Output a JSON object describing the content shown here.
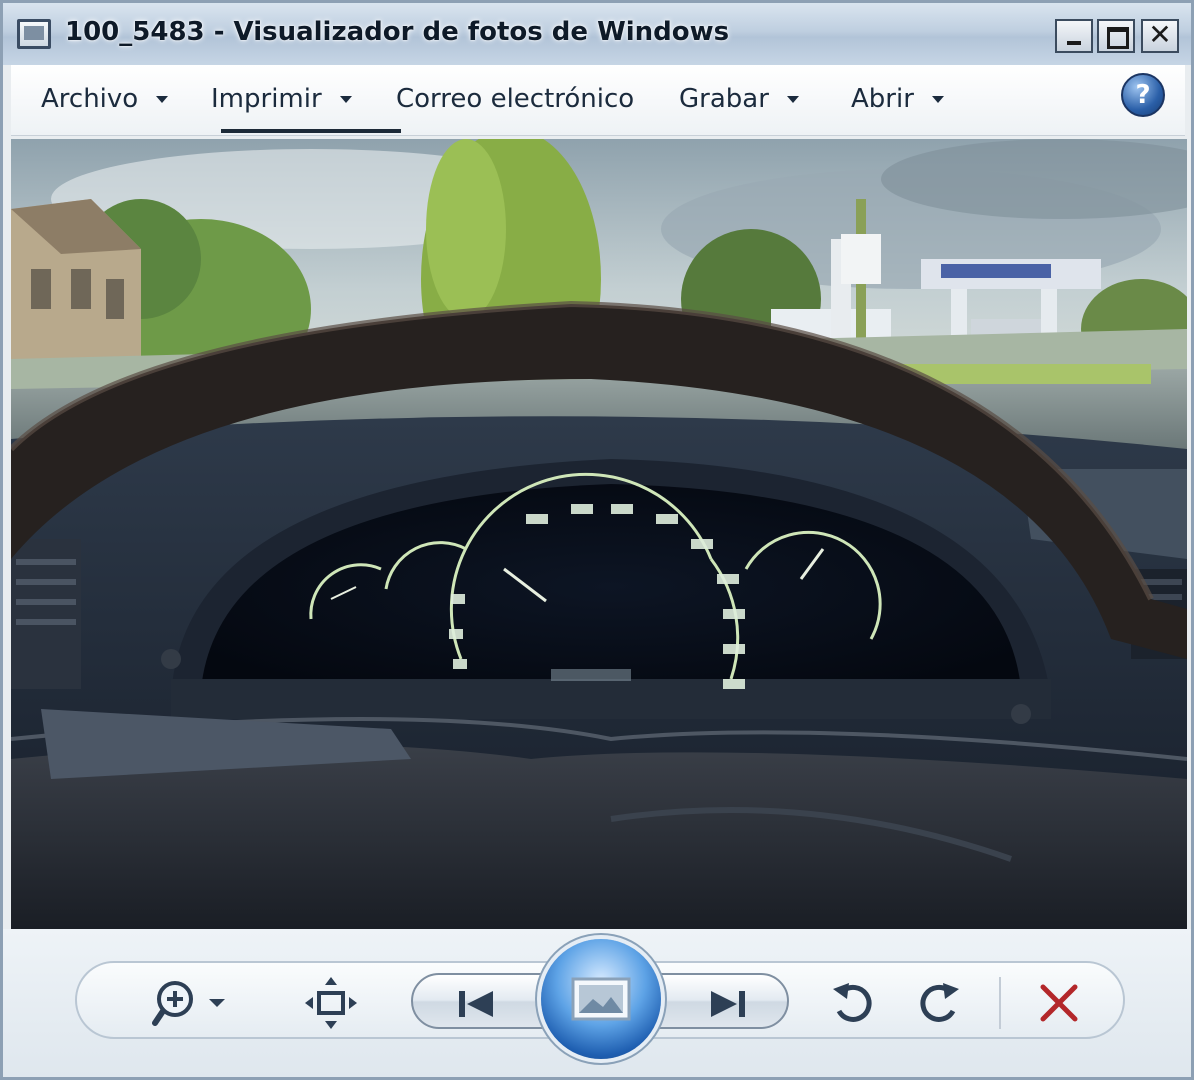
{
  "window": {
    "title": "100_5483 - Visualizador de fotos de Windows",
    "icon": "photo-viewer-icon",
    "controls": [
      "minimize-icon",
      "maximize-icon",
      "close-icon"
    ]
  },
  "menubar": {
    "items": [
      {
        "label": "Archivo",
        "has_dropdown": true
      },
      {
        "label": "Imprimir",
        "has_dropdown": true
      },
      {
        "label": "Correo electrónico",
        "has_dropdown": false
      },
      {
        "label": "Grabar",
        "has_dropdown": true
      },
      {
        "label": "Abrir",
        "has_dropdown": true
      }
    ],
    "help": "?"
  },
  "viewer": {
    "photo_description_icon": "car-dashboard-photo"
  },
  "controls": {
    "zoom": "zoom-in-icon",
    "fit": "actual-size-icon",
    "previous": "previous-icon",
    "slideshow": "slideshow-icon",
    "next": "next-icon",
    "rotate_left": "rotate-counterclockwise-icon",
    "rotate_right": "rotate-clockwise-icon",
    "delete": "delete-icon",
    "delete_color": "#b3272a"
  }
}
